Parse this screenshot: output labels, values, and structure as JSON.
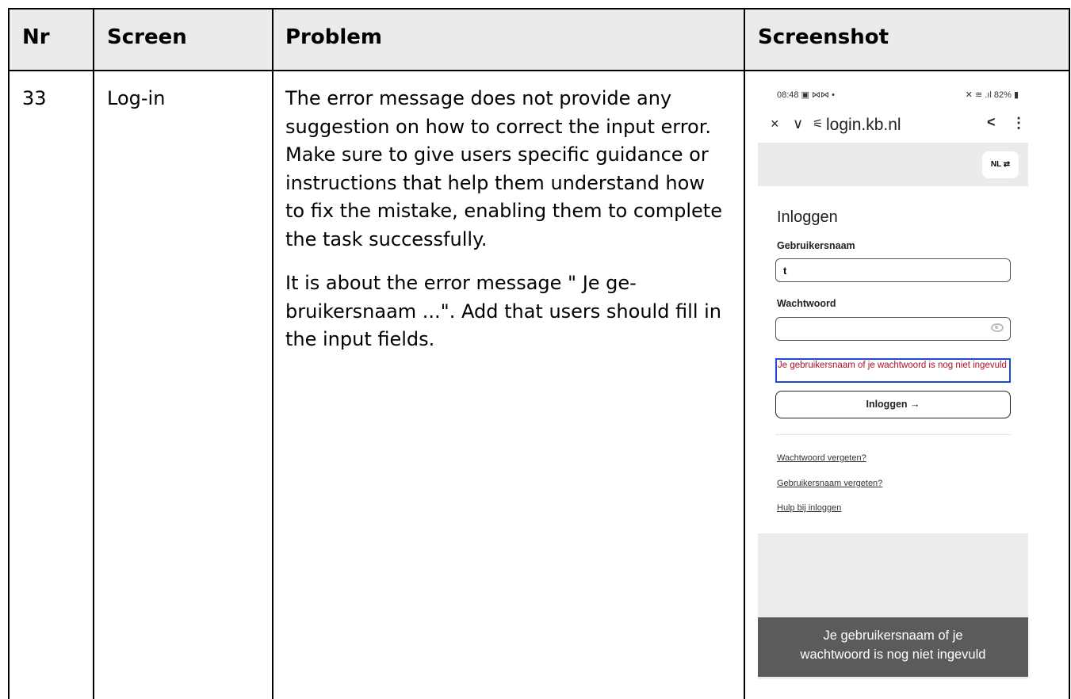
{
  "table": {
    "headers": [
      "Nr",
      "Screen",
      "Problem",
      "Screenshot"
    ],
    "row": {
      "nr": "33",
      "screen": "Log-in",
      "problem_paragraphs": [
        "The error message does not provide any suggestion on how to correct the input error. Make sure to give users specific guidance or instructions that help them understand how to fix the mistake, enabling them to complete the task successfully.",
        "It is about the error message \" Je ge-bruikersnaam ...\". Add that users should fill in the input fields."
      ]
    }
  },
  "phone": {
    "status_time": "08:48",
    "status_icons_left": "▣ ⋈⋈ •",
    "battery": "82%",
    "status_icons_right": "✕ ≋ .ıl",
    "url": "login.kb.nl",
    "language_button": "NL ⇄",
    "login_title": "Inloggen",
    "username_label": "Gebruikersnaam",
    "username_value": "t",
    "password_label": "Wachtwoord",
    "error_text": "Je gebruikersnaam of je wachtwoord is nog niet ingevuld",
    "login_button": "Inloggen →",
    "links": [
      "Wachtwoord vergeten?",
      "Gebruikersnaam vergeten?",
      "Hulp bij inloggen"
    ],
    "toast_line1": "Je gebruikersnaam of je",
    "toast_line2": "wachtwoord is nog niet ingevuld",
    "icons": {
      "close": "×",
      "chevron": "∨",
      "settings": "⚟",
      "share": "<",
      "menu": "⋮"
    }
  }
}
